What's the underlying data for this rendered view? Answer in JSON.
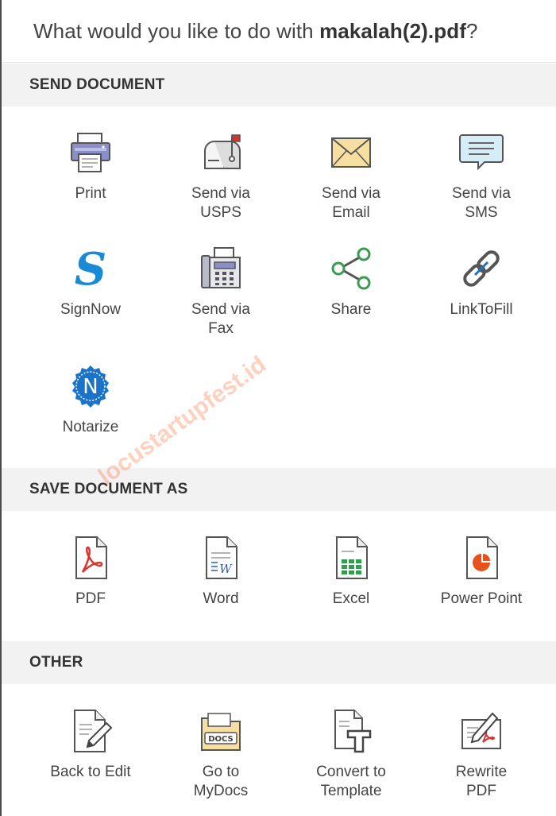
{
  "dialog": {
    "title_prefix": "What would you like to do with ",
    "filename": "makalah(2).pdf",
    "title_suffix": "?"
  },
  "sections": {
    "send": {
      "header": "SEND DOCUMENT",
      "items": [
        {
          "label": "Print",
          "icon": "printer-icon"
        },
        {
          "label": "Send via\nUSPS",
          "icon": "mailbox-icon"
        },
        {
          "label": "Send via\nEmail",
          "icon": "envelope-icon"
        },
        {
          "label": "Send via\nSMS",
          "icon": "sms-bubble-icon"
        },
        {
          "label": "SignNow",
          "icon": "signnow-logo-icon"
        },
        {
          "label": "Send via\nFax",
          "icon": "fax-machine-icon"
        },
        {
          "label": "Share",
          "icon": "share-icon"
        },
        {
          "label": "LinkToFill",
          "icon": "chain-link-icon"
        },
        {
          "label": "Notarize",
          "icon": "notary-seal-icon"
        }
      ]
    },
    "save": {
      "header": "SAVE DOCUMENT AS",
      "items": [
        {
          "label": "PDF",
          "icon": "pdf-file-icon"
        },
        {
          "label": "Word",
          "icon": "word-file-icon"
        },
        {
          "label": "Excel",
          "icon": "excel-file-icon"
        },
        {
          "label": "Power Point",
          "icon": "powerpoint-file-icon"
        }
      ]
    },
    "other": {
      "header": "OTHER",
      "items": [
        {
          "label": "Back to Edit",
          "icon": "edit-document-icon"
        },
        {
          "label": "Go to\nMyDocs",
          "icon": "docs-folder-icon"
        },
        {
          "label": "Convert to\nTemplate",
          "icon": "template-icon"
        },
        {
          "label": "Rewrite\nPDF",
          "icon": "rewrite-pdf-icon"
        }
      ]
    }
  },
  "watermark": "locustartupfest.id",
  "colors": {
    "accent_blue": "#1a73c8",
    "pdf_red": "#d9342b",
    "excel_green": "#2f9e4f",
    "ppt_orange": "#e8501c"
  }
}
